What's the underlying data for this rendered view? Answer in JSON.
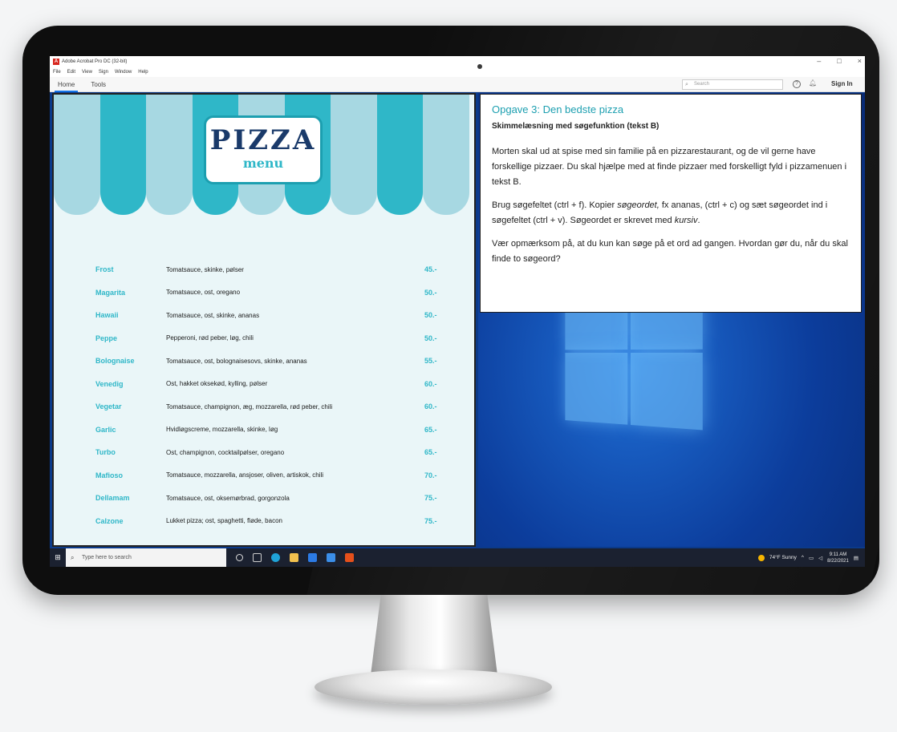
{
  "acrobat": {
    "title": "Adobe Acrobat Pro DC (32-bit)",
    "menu": [
      "File",
      "Edit",
      "View",
      "Sign",
      "Window",
      "Help"
    ],
    "tabs": [
      "Home",
      "Tools"
    ],
    "search_placeholder": "Search",
    "signin": "Sign In",
    "window_controls": [
      "–",
      "□",
      "×"
    ]
  },
  "pizza_doc": {
    "logo_title": "PIZZA",
    "logo_subtitle": "menu",
    "items": [
      {
        "name": "Frost",
        "desc": "Tomatsauce, skinke, pølser",
        "price": "45.-"
      },
      {
        "name": "Magarita",
        "desc": "Tomatsauce, ost, oregano",
        "price": "50.-"
      },
      {
        "name": "Hawaii",
        "desc": "Tomatsauce, ost, skinke, ananas",
        "price": "50.-"
      },
      {
        "name": "Peppe",
        "desc": "Pepperoni, rød peber, løg, chili",
        "price": "50.-"
      },
      {
        "name": "Bolognaise",
        "desc": "Tomatsauce, ost, bolognaisesovs, skinke, ananas",
        "price": "55.-"
      },
      {
        "name": "Venedig",
        "desc": "Ost, hakket oksekød, kylling, pølser",
        "price": "60.-"
      },
      {
        "name": "Vegetar",
        "desc": "Tomatsauce, champignon, æg, mozzarella, rød peber, chili",
        "price": "60.-"
      },
      {
        "name": "Garlic",
        "desc": "Hvidløgscreme, mozzarella, skinke, løg",
        "price": "65.-"
      },
      {
        "name": "Turbo",
        "desc": "Ost, champignon, cocktailpølser, oregano",
        "price": "65.-"
      },
      {
        "name": "Mafioso",
        "desc": "Tomatsauce, mozzarella, ansjoser, oliven, artiskok, chili",
        "price": "70.-"
      },
      {
        "name": "Dellamam",
        "desc": "Tomatsauce, ost, oksemørbrad, gorgonzola",
        "price": "75.-"
      },
      {
        "name": "Calzone",
        "desc": "Lukket pizza; ost, spaghetti, fløde, bacon",
        "price": "75.-"
      }
    ]
  },
  "task": {
    "title": "Opgave 3: Den bedste pizza",
    "subtitle": "Skimmelæsning med søgefunktion (tekst B)",
    "p1": "Morten skal ud at spise med sin familie på en pizzarestaurant, og de vil gerne have forskellige pizzaer. Du skal hjælpe med at finde pizzaer med forskelligt fyld i pizzamenuen i tekst B.",
    "p2_a": "Brug søgefeltet (ctrl + f). Kopier ",
    "p2_b": "søgeordet,",
    "p2_c": " fx ananas, (ctrl + c) og sæt søgeordet ind i søgefeltet (ctrl + v). Søgeordet er skrevet med ",
    "p2_d": "kursiv",
    "p2_e": ".",
    "p3": "Vær opmærksom på, at du kun kan søge på et ord ad gangen. Hvordan gør du, når du skal finde to søgeord?"
  },
  "taskbar": {
    "search_placeholder": "Type here to search",
    "weather": "74°F Sunny",
    "time": "9:11 AM",
    "date": "8/22/2021"
  },
  "colors": {
    "awning_light": "#a7d8e2",
    "awning_dark": "#2fb7c8",
    "accent_teal": "#2fb7c8",
    "logo_navy": "#1a3a6a",
    "acrobat_red": "#d7261e"
  }
}
